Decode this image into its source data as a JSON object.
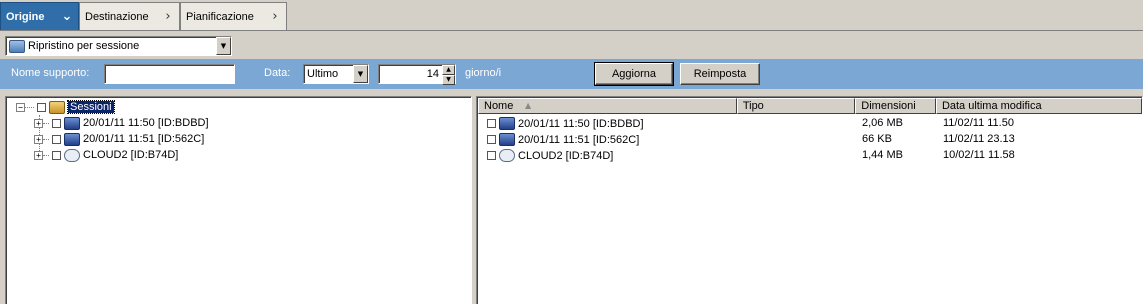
{
  "tabs": [
    {
      "label": "Origine",
      "active": true
    },
    {
      "label": "Destinazione",
      "active": false
    },
    {
      "label": "Pianificazione",
      "active": false
    }
  ],
  "mode_select": {
    "value": "Ripristino per sessione",
    "icon": "restore-icon"
  },
  "filter": {
    "media_label": "Nome supporto:",
    "media_value": "",
    "date_label": "Data:",
    "date_value": "Ultimo",
    "days_value": "14",
    "days_unit": "giorno/i",
    "refresh_label": "Aggiorna",
    "reset_label": "Reimposta"
  },
  "tree": {
    "root": {
      "label": "Sessioni",
      "icon": "sessions-folder-icon",
      "selected": true
    },
    "items": [
      {
        "label": "20/01/11 11:50 [ID:BDBD]",
        "icon": "session-icon"
      },
      {
        "label": "20/01/11 11:51 [ID:562C]",
        "icon": "session-icon"
      },
      {
        "label": "CLOUD2 [ID:B74D]",
        "icon": "cloud-icon"
      }
    ]
  },
  "list": {
    "columns": [
      "Nome",
      "Tipo",
      "Dimensioni",
      "Data ultima modifica"
    ],
    "rows": [
      {
        "name": "20/01/11 11:50 [ID:BDBD]",
        "type": "",
        "size": "2,06 MB",
        "modified": "11/02/11  11.50",
        "icon": "session-icon"
      },
      {
        "name": "20/01/11 11:51 [ID:562C]",
        "type": "",
        "size": "66 KB",
        "modified": "11/02/11  23.13",
        "icon": "session-icon"
      },
      {
        "name": "CLOUD2 [ID:B74D]",
        "type": "",
        "size": "1,44 MB",
        "modified": "10/02/11  11.58",
        "icon": "cloud-icon"
      }
    ]
  }
}
